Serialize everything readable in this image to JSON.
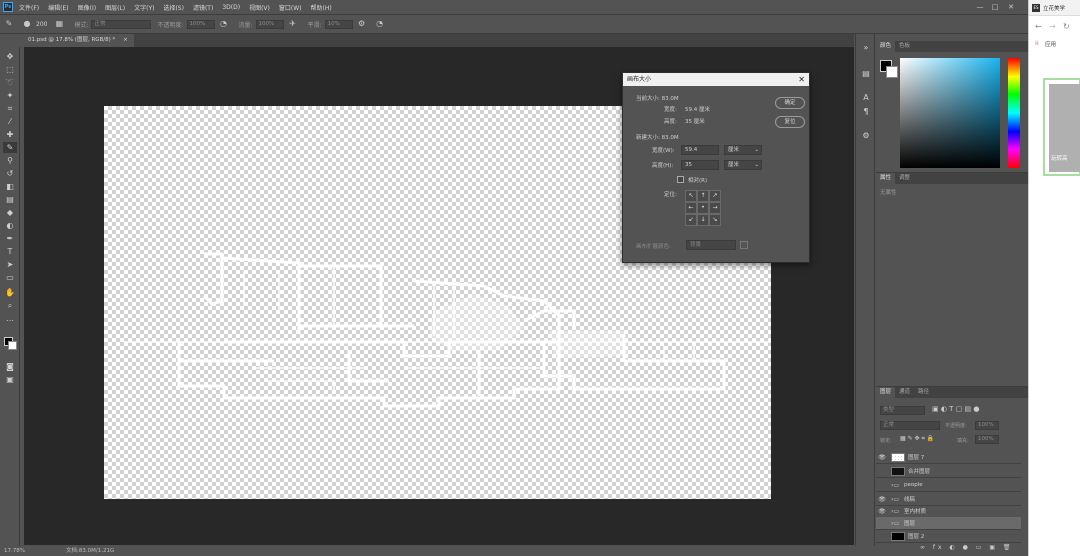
{
  "app": {
    "logo": "Ps",
    "menu": [
      "文件(F)",
      "编辑(E)",
      "图像(I)",
      "图层(L)",
      "文字(Y)",
      "选择(S)",
      "滤镜(T)",
      "3D(D)",
      "视图(V)",
      "窗口(W)",
      "帮助(H)"
    ],
    "window_controls": [
      "—",
      "□",
      "✕"
    ]
  },
  "options_bar": {
    "brush_size": "200",
    "mode_label": "模式:",
    "mode_value": "正常",
    "opacity_label": "不透明度:",
    "opacity_value": "100%",
    "flow_label": "流量:",
    "flow_value": "100%",
    "smooth_label": "平滑:",
    "smooth_value": "10%"
  },
  "document_tab": {
    "label": "01.psd @ 17.8% (图层, RGB/8) *",
    "close": "×"
  },
  "status_bar": {
    "zoom": "17.78%",
    "doc_info": "文档:83.0M/1.21G"
  },
  "dialog": {
    "title": "画布大小",
    "close": "✕",
    "current_size_label": "当前大小: 83.0M",
    "current_width_label": "宽度:",
    "current_width_value": "59.4 厘米",
    "current_height_label": "高度:",
    "current_height_value": "35 厘米",
    "new_size_label": "新建大小: 83.0M",
    "width_label": "宽度(W):",
    "width_value": "59.4",
    "width_unit": "厘米",
    "height_label": "高度(H):",
    "height_value": "35",
    "height_unit": "厘米",
    "relative_label": "相对(R)",
    "anchor_label": "定位:",
    "extension_label": "画布扩展颜色:",
    "extension_value": "背景",
    "ok_label": "确定",
    "cancel_label": "复位",
    "anchor_arrows": [
      "↖",
      "↑",
      "↗",
      "←",
      "•",
      "→",
      "↙",
      "↓",
      "↘"
    ]
  },
  "panels": {
    "color_tabs": [
      "颜色",
      "色板"
    ],
    "properties_tabs": [
      "属性",
      "调整"
    ],
    "properties_empty": "无属性",
    "layers_tabs": [
      "图层",
      "通道",
      "路径"
    ],
    "layer_filter": "类型",
    "blend_mode": "正常",
    "opacity_label": "不透明度:",
    "opacity_value": "100%",
    "lock_label": "锁定:",
    "fill_label": "填充:",
    "fill_value": "100%",
    "layers": [
      {
        "name": "图层 7",
        "visible": true,
        "kind": "layer"
      },
      {
        "name": "合并图层",
        "visible": false,
        "kind": "layer"
      },
      {
        "name": "people",
        "visible": false,
        "kind": "folder"
      },
      {
        "name": "线稿",
        "visible": true,
        "kind": "folder"
      },
      {
        "name": "室内材质",
        "visible": true,
        "kind": "folder"
      },
      {
        "name": "图层",
        "visible": false,
        "kind": "folder"
      },
      {
        "name": "图层 2",
        "visible": false,
        "kind": "layer"
      }
    ],
    "colors": {
      "foreground": "#000000",
      "background": "#ffffff",
      "hue": "#18b4f0"
    }
  },
  "browser": {
    "title": "立花美学",
    "bookmarks_label": "应用",
    "card_text": "玩转高"
  }
}
